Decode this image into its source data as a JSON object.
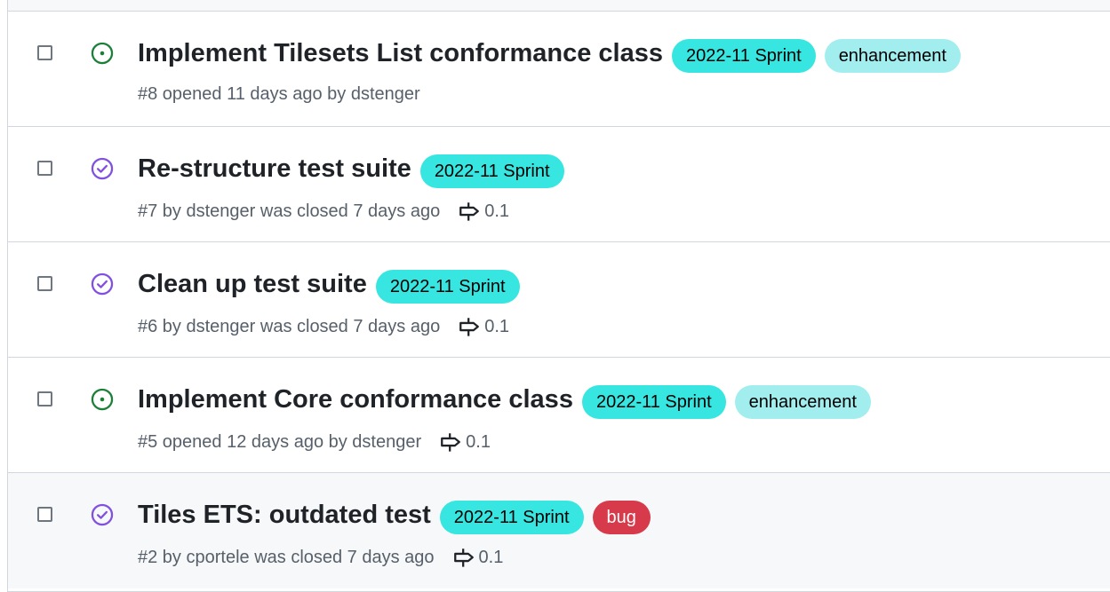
{
  "colors": {
    "open_icon": "#1a7f37",
    "closed_icon": "#8250df",
    "sprint_label_bg": "#37e6e0",
    "enhancement_label_bg": "#a2eeef",
    "bug_label_bg": "#d73a4a",
    "bug_label_text": "#ffffff"
  },
  "issues": [
    {
      "state": "open",
      "title": "Implement Tilesets List conformance class",
      "labels": [
        "2022-11 Sprint",
        "enhancement"
      ],
      "meta": "#8 opened 11 days ago by dstenger",
      "milestone": ""
    },
    {
      "state": "closed",
      "title": "Re-structure test suite",
      "labels": [
        "2022-11 Sprint"
      ],
      "meta": "#7 by dstenger was closed 7 days ago",
      "milestone": "0.1"
    },
    {
      "state": "closed",
      "title": "Clean up test suite",
      "labels": [
        "2022-11 Sprint"
      ],
      "meta": "#6 by dstenger was closed 7 days ago",
      "milestone": "0.1"
    },
    {
      "state": "open",
      "title": "Implement Core conformance class",
      "labels": [
        "2022-11 Sprint",
        "enhancement"
      ],
      "meta": "#5 opened 12 days ago by dstenger",
      "milestone": "0.1"
    },
    {
      "state": "closed",
      "title": "Tiles ETS: outdated test",
      "labels": [
        "2022-11 Sprint",
        "bug"
      ],
      "meta": "#2 by cportele was closed 7 days ago",
      "milestone": "0.1"
    }
  ]
}
